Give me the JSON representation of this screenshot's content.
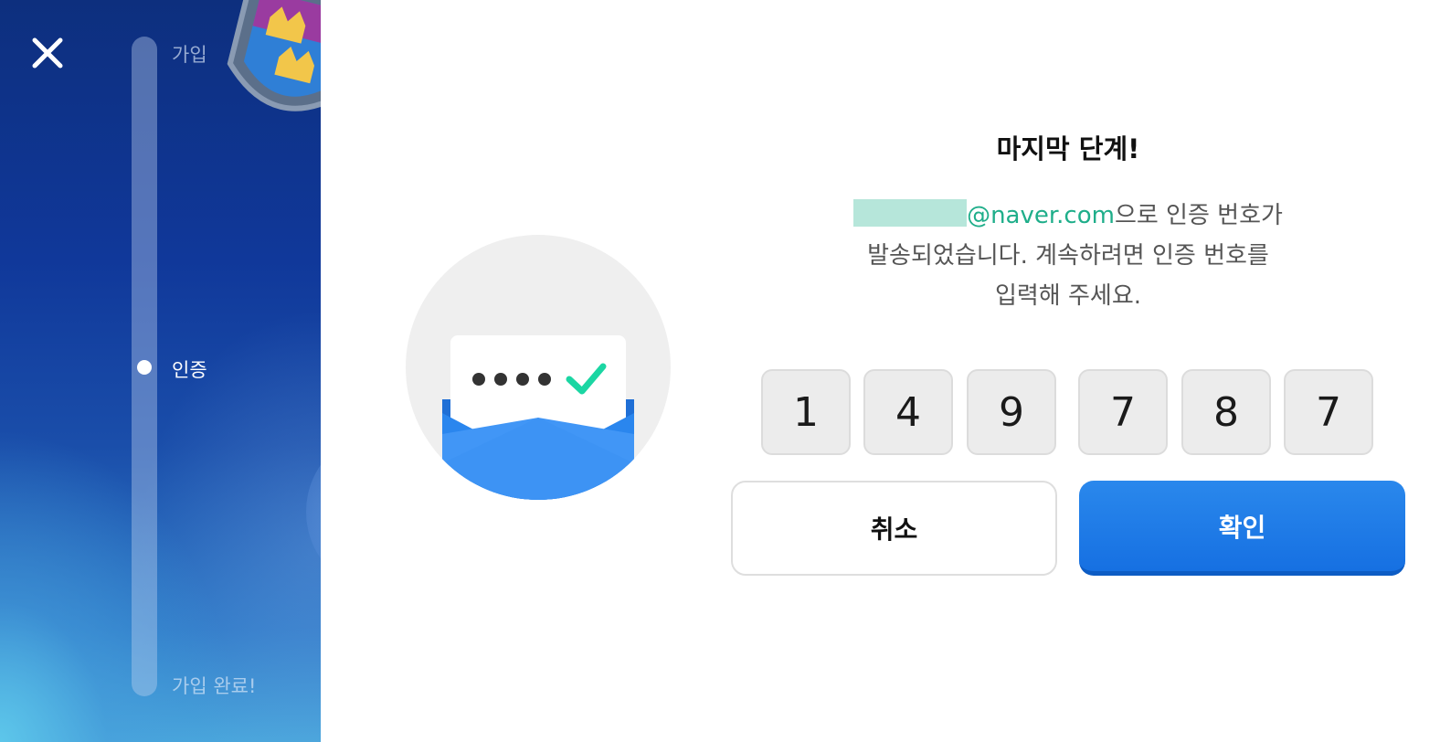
{
  "sidebar": {
    "steps": [
      {
        "label": "가입"
      },
      {
        "label": "인증"
      },
      {
        "label": "가입 완료!"
      }
    ],
    "current_step": "인증"
  },
  "verification": {
    "title": "마지막 단계!",
    "email_domain": "@naver.com",
    "line1_suffix": "으로 인증 번호가",
    "line2": "발송되었습니다. 계속하려면 인증 번호를",
    "line3": "입력해 주세요.",
    "code_digits": [
      "1",
      "4",
      "9",
      "7",
      "8",
      "7"
    ]
  },
  "buttons": {
    "cancel_label": "취소",
    "confirm_label": "확인"
  },
  "colors": {
    "accent": "#1670e2",
    "email_highlight": "#1fae8a",
    "checkmark": "#1bd6a3"
  },
  "icons": [
    "close-icon",
    "envelope-check-icon"
  ]
}
